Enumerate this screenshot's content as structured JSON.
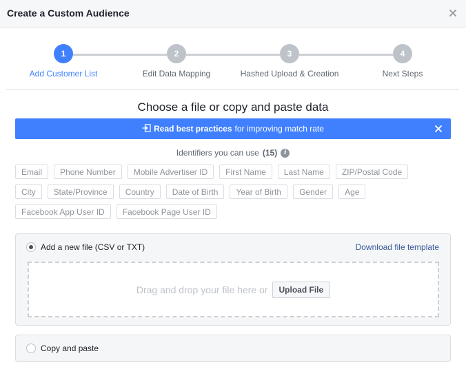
{
  "header": {
    "title": "Create a Custom Audience",
    "close_icon": "close-icon"
  },
  "stepper": {
    "steps": [
      {
        "number": "1",
        "label": "Add Customer List",
        "active": true
      },
      {
        "number": "2",
        "label": "Edit Data Mapping",
        "active": false
      },
      {
        "number": "3",
        "label": "Hashed Upload & Creation",
        "active": false
      },
      {
        "number": "4",
        "label": "Next Steps",
        "active": false
      }
    ]
  },
  "main": {
    "title": "Choose a file or copy and paste data"
  },
  "banner": {
    "strong": "Read best practices",
    "rest": "for improving match rate",
    "icon": "external-link-icon",
    "close_icon": "close-icon",
    "color": "#4080ff"
  },
  "identifiers": {
    "label": "Identifiers you can use",
    "count": "(15)",
    "info_icon": "info-icon",
    "rows": [
      [
        "Email",
        "Phone Number",
        "Mobile Advertiser ID",
        "First Name",
        "Last Name",
        "ZIP/Postal Code"
      ],
      [
        "City",
        "State/Province",
        "Country",
        "Date of Birth",
        "Year of Birth",
        "Gender",
        "Age"
      ],
      [
        "Facebook App User ID",
        "Facebook Page User ID"
      ]
    ]
  },
  "upload_option": {
    "label": "Add a new file (CSV or TXT)",
    "selected": true,
    "download_link": "Download file template",
    "dropzone_text": "Drag and drop your file here or",
    "upload_button": "Upload File"
  },
  "paste_option": {
    "label": "Copy and paste",
    "selected": false
  },
  "colors": {
    "accent": "#4080ff",
    "link": "#365899",
    "step_inactive": "#bec2c9"
  }
}
